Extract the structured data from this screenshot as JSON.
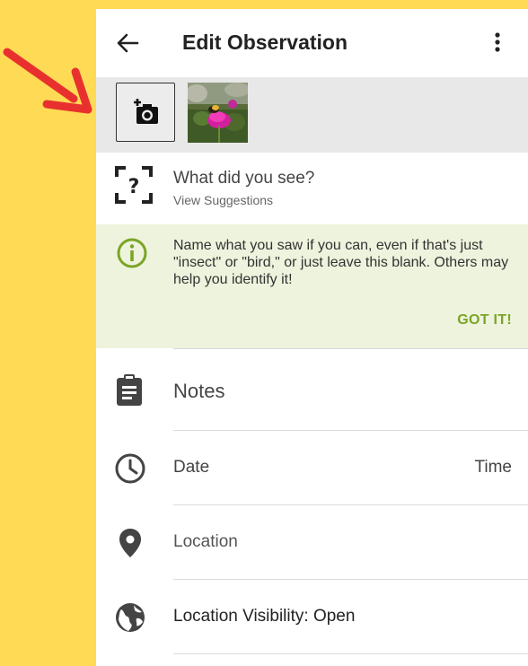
{
  "header": {
    "title": "Edit Observation"
  },
  "species": {
    "prompt": "What did you see?",
    "suggestions_link": "View Suggestions"
  },
  "tip": {
    "text": "Name what you saw if you can, even if that's just \"insect\" or \"bird,\" or just leave this blank. Others may help you identify it!",
    "dismiss_label": "GOT IT!"
  },
  "fields": {
    "notes_placeholder": "Notes",
    "date_label": "Date",
    "time_label": "Time",
    "location_label": "Location",
    "visibility_label": "Location Visibility: Open"
  },
  "colors": {
    "background": "#FFDA55",
    "accent_green": "#7aa526",
    "tip_background": "#eef3dd",
    "arrow_red": "#e8312e"
  },
  "icons": [
    "back-arrow-icon",
    "more-vert-icon",
    "add-photo-icon",
    "unknown-species-icon",
    "info-icon",
    "clipboard-icon",
    "clock-icon",
    "location-pin-icon",
    "globe-icon"
  ]
}
